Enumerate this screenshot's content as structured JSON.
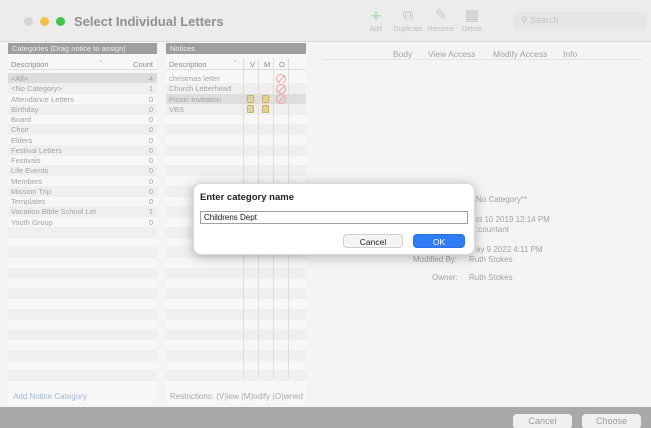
{
  "window": {
    "title": "Select Individual Letters",
    "toolbar": [
      {
        "label": "Add",
        "icon": "plus-icon"
      },
      {
        "label": "Duplicate",
        "icon": "duplicate-icon"
      },
      {
        "label": "Rename",
        "icon": "rename-icon"
      },
      {
        "label": "Delete",
        "icon": "trash-icon"
      }
    ],
    "search_placeholder": "Search"
  },
  "categories": {
    "header": "Categories (Drag notice to assign)",
    "col_description": "Description",
    "col_count": "Count",
    "items": [
      {
        "name": "<All>",
        "count": "4"
      },
      {
        "name": "<No Category>",
        "count": "1"
      },
      {
        "name": "Attendance Letters",
        "count": "0"
      },
      {
        "name": "Birthday",
        "count": "0"
      },
      {
        "name": "Board",
        "count": "0"
      },
      {
        "name": "Choir",
        "count": "0"
      },
      {
        "name": "Elders",
        "count": "0"
      },
      {
        "name": "Festival Letters",
        "count": "0"
      },
      {
        "name": "Festivals",
        "count": "0"
      },
      {
        "name": "Life Events",
        "count": "0"
      },
      {
        "name": "Members",
        "count": "0"
      },
      {
        "name": "Mission Trip",
        "count": "0"
      },
      {
        "name": "Templates",
        "count": "0"
      },
      {
        "name": "Vacation Bible School Let",
        "count": "1"
      },
      {
        "name": "Youth Group",
        "count": "0"
      }
    ],
    "add_link": "Add Notice Category"
  },
  "notices": {
    "header": "Notices",
    "col_description": "Description",
    "col_v": "V",
    "col_m": "M",
    "col_o": "O",
    "items": [
      {
        "name": "christmas letter",
        "v": false,
        "m": false,
        "o": true
      },
      {
        "name": "Church Letterhead",
        "v": false,
        "m": false,
        "o": true
      },
      {
        "name": "Picnic Invitation",
        "v": true,
        "m": true,
        "o": true
      },
      {
        "name": "VBS",
        "v": true,
        "m": true,
        "o": false
      }
    ],
    "restrictions": "Restrictions: (V)iew (M)odify (O)wned"
  },
  "tabs": [
    "Body",
    "View Access",
    "Modify Access",
    "Info"
  ],
  "info": {
    "category_value": "No Category**",
    "created_value": "ct 10 2019 12:14 PM",
    "created_by_value": ":countant",
    "modified_value": "ay 9 2022 4:11 PM",
    "modified_by_label": "Modified By:",
    "modified_by_value": "Ruth Stokes",
    "owner_label": "Owner:",
    "owner_value": "Ruth Stokes"
  },
  "bottom": {
    "cancel": "Cancel",
    "choose": "Choose"
  },
  "dialog": {
    "title": "Enter category name",
    "input_value": "Childrens Dept",
    "cancel": "Cancel",
    "ok": "OK"
  },
  "colors": {
    "accent": "#2f7cf5",
    "lock": "#e2d29a",
    "no_entry": "#eca1a1"
  }
}
